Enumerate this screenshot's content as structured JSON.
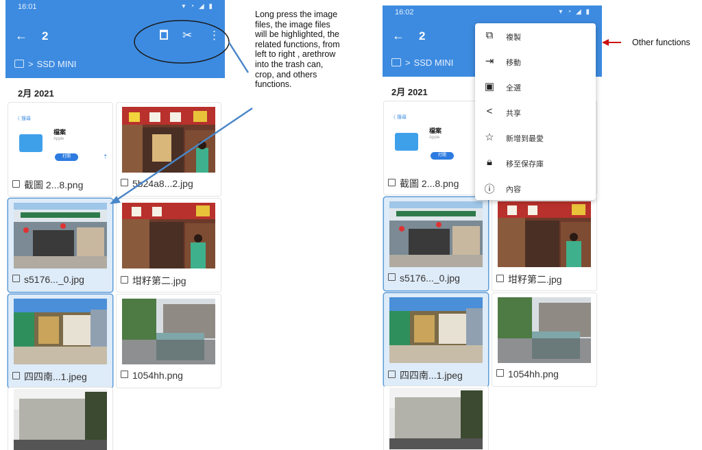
{
  "left_screen": {
    "status_time": "16:01",
    "selected_count": "2",
    "breadcrumb": "SSD MINI",
    "date_header": "2月 2021",
    "files": [
      {
        "name": "截圖 2...8.png",
        "selected": false
      },
      {
        "name": "5b24a8...2.jpg",
        "selected": false
      },
      {
        "name": "s5176..._0.jpg",
        "selected": true
      },
      {
        "name": "坩籽第二.jpg",
        "selected": false
      },
      {
        "name": "四四南...1.jpeg",
        "selected": true
      },
      {
        "name": "1054hh.png",
        "selected": false
      }
    ],
    "screenshot_thumb": {
      "title": "檔案",
      "subtitle": "Apple",
      "button": "打開",
      "back": "〈 搜尋"
    }
  },
  "right_screen": {
    "status_time": "16:02",
    "selected_count": "2",
    "breadcrumb": "SSD MINI",
    "date_header": "2月 2021",
    "files": [
      {
        "name": "截圖 2...8.png",
        "selected": false
      },
      {
        "name": "",
        "selected": false
      },
      {
        "name": "s5176..._0.jpg",
        "selected": true
      },
      {
        "name": "坩籽第二.jpg",
        "selected": false
      },
      {
        "name": "四四南...1.jpeg",
        "selected": true
      },
      {
        "name": "1054hh.png",
        "selected": false
      }
    ],
    "screenshot_thumb": {
      "title": "檔案",
      "subtitle": "Apple",
      "button": "打開",
      "back": "〈 搜尋"
    },
    "menu": [
      {
        "label": "複製",
        "icon": "copy-icon"
      },
      {
        "label": "移動",
        "icon": "move-icon"
      },
      {
        "label": "全選",
        "icon": "select-all-icon"
      },
      {
        "label": "共享",
        "icon": "share-icon"
      },
      {
        "label": "新增到最愛",
        "icon": "star-icon"
      },
      {
        "label": "移至保存庫",
        "icon": "lock-icon"
      },
      {
        "label": "內容",
        "icon": "info-icon"
      }
    ]
  },
  "annotations": {
    "left_note": "Long press the image files, the image files will be highlighted, the related functions, from left to right , arethrow into the trash can, crop, and others functions.",
    "right_note": "Other functions"
  },
  "colors": {
    "app_bar": "#3d8be0",
    "selection_bg": "#deebf8",
    "selection_border": "#5b9bd8",
    "arrow_blue": "#4a86c8",
    "arrow_red": "#cc1111"
  }
}
